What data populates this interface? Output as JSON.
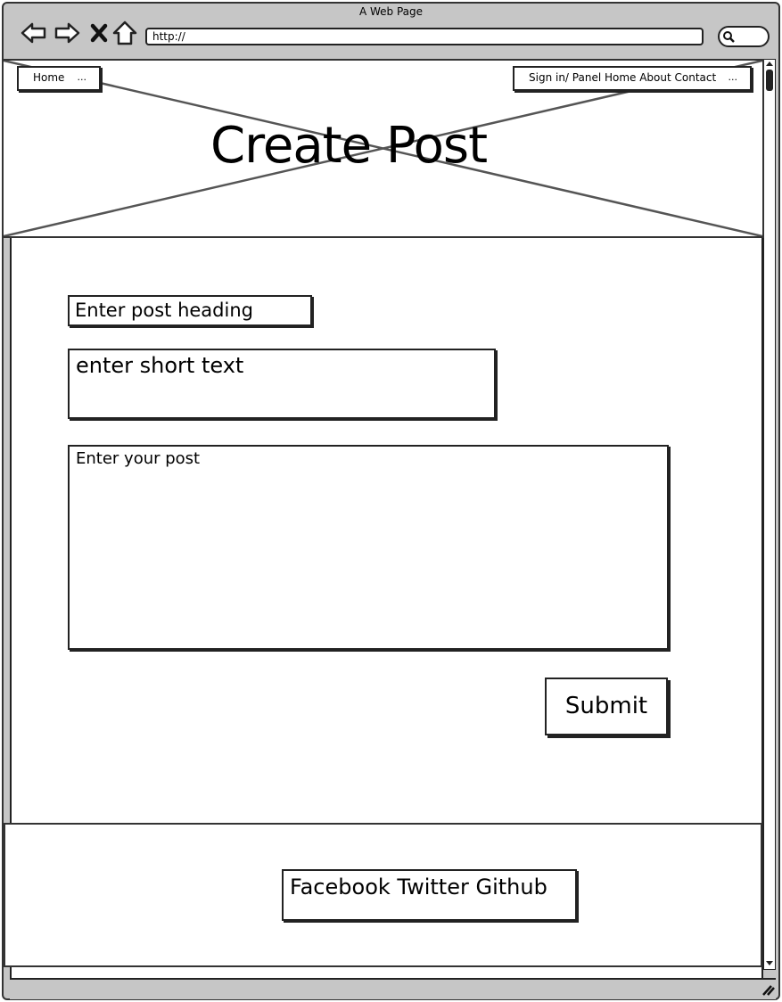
{
  "window": {
    "title": "A Web Page"
  },
  "address_bar": {
    "url": "http://"
  },
  "header": {
    "title": "Create Post"
  },
  "nav_left": {
    "label": "Home",
    "overflow": "..."
  },
  "nav_right": {
    "label": "Sign in/ Panel Home About Contact",
    "overflow": "..."
  },
  "form": {
    "heading_placeholder": "Enter post heading",
    "short_text_placeholder": "enter short text",
    "post_placeholder": "Enter your post",
    "submit_label": "Submit"
  },
  "footer": {
    "links": "Facebook Twitter Github"
  },
  "icons": [
    "back-icon",
    "forward-icon",
    "close-icon",
    "home-icon",
    "search-icon",
    "resize-grip-icon"
  ]
}
